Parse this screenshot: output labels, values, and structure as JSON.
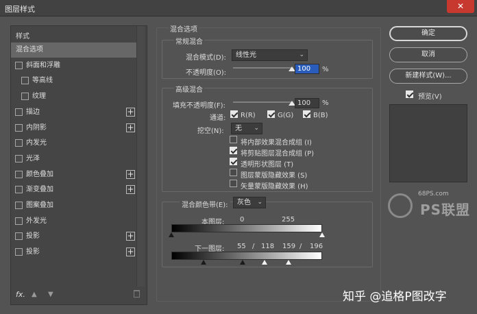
{
  "window": {
    "title": "图层样式",
    "close_icon": "close-icon"
  },
  "left": {
    "header": "样式",
    "items": [
      {
        "label": "混合选项",
        "checkbox": false,
        "plus": false,
        "selected": true,
        "indent": 0
      },
      {
        "label": "斜面和浮雕",
        "checkbox": true,
        "checked": false,
        "plus": false,
        "indent": 0
      },
      {
        "label": "等高线",
        "checkbox": true,
        "checked": false,
        "plus": false,
        "indent": 1
      },
      {
        "label": "纹理",
        "checkbox": true,
        "checked": false,
        "plus": false,
        "indent": 1
      },
      {
        "label": "描边",
        "checkbox": true,
        "checked": false,
        "plus": true,
        "indent": 0
      },
      {
        "label": "内阴影",
        "checkbox": true,
        "checked": false,
        "plus": true,
        "indent": 0
      },
      {
        "label": "内发光",
        "checkbox": true,
        "checked": false,
        "plus": false,
        "indent": 0
      },
      {
        "label": "光泽",
        "checkbox": true,
        "checked": false,
        "plus": false,
        "indent": 0
      },
      {
        "label": "颜色叠加",
        "checkbox": true,
        "checked": false,
        "plus": true,
        "indent": 0
      },
      {
        "label": "渐变叠加",
        "checkbox": true,
        "checked": false,
        "plus": true,
        "indent": 0
      },
      {
        "label": "图案叠加",
        "checkbox": true,
        "checked": false,
        "plus": false,
        "indent": 0
      },
      {
        "label": "外发光",
        "checkbox": true,
        "checked": false,
        "plus": false,
        "indent": 0
      },
      {
        "label": "投影",
        "checkbox": true,
        "checked": false,
        "plus": true,
        "indent": 0
      },
      {
        "label": "投影",
        "checkbox": true,
        "checked": false,
        "plus": true,
        "indent": 0
      }
    ],
    "footer": {
      "fx": "fx",
      "fx_dot": ".",
      "up_icon": "arrow-up-icon",
      "down_icon": "arrow-down-icon",
      "trash_icon": "trash-icon"
    }
  },
  "blend": {
    "section_title": "混合选项",
    "general": {
      "title": "常规混合",
      "mode_label": "混合模式(D):",
      "mode_value": "线性光",
      "opacity_label": "不透明度(O):",
      "opacity_value": "100",
      "opacity_unit": "%",
      "opacity_fraction": 1.0
    },
    "advanced": {
      "title": "高级混合",
      "fill_label": "填充不透明度(F):",
      "fill_value": "100",
      "fill_unit": "%",
      "fill_fraction": 1.0,
      "channels_label": "通道:",
      "channels": [
        {
          "label": "R(R)",
          "checked": true
        },
        {
          "label": "G(G)",
          "checked": true
        },
        {
          "label": "B(B)",
          "checked": true
        }
      ],
      "knockout_label": "挖空(N):",
      "knockout_value": "无",
      "options": [
        {
          "label": "将内部效果混合成组 (I)",
          "checked": false
        },
        {
          "label": "将剪贴图层混合成组 (P)",
          "checked": true
        },
        {
          "label": "透明形状图层 (T)",
          "checked": true
        },
        {
          "label": "图层蒙版隐藏效果 (S)",
          "checked": false
        },
        {
          "label": "矢量蒙版隐藏效果 (H)",
          "checked": false
        }
      ]
    },
    "blendif": {
      "label": "混合颜色带(E):",
      "value": "灰色",
      "this_layer_label": "本图层:",
      "this_layer_low": "0",
      "this_layer_high": "255",
      "underlying_label": "下一图层:",
      "underlying_values": [
        "55",
        "/",
        "118",
        "159",
        "/",
        "196"
      ]
    }
  },
  "buttons": {
    "ok": "确定",
    "cancel": "取消",
    "new_style": "新建样式(W)...",
    "preview_label": "预览(V)",
    "preview_checked": true
  },
  "watermarks": {
    "site": "68PS.com",
    "brand": "PS联盟",
    "author": "知乎 @追格P图改字"
  }
}
